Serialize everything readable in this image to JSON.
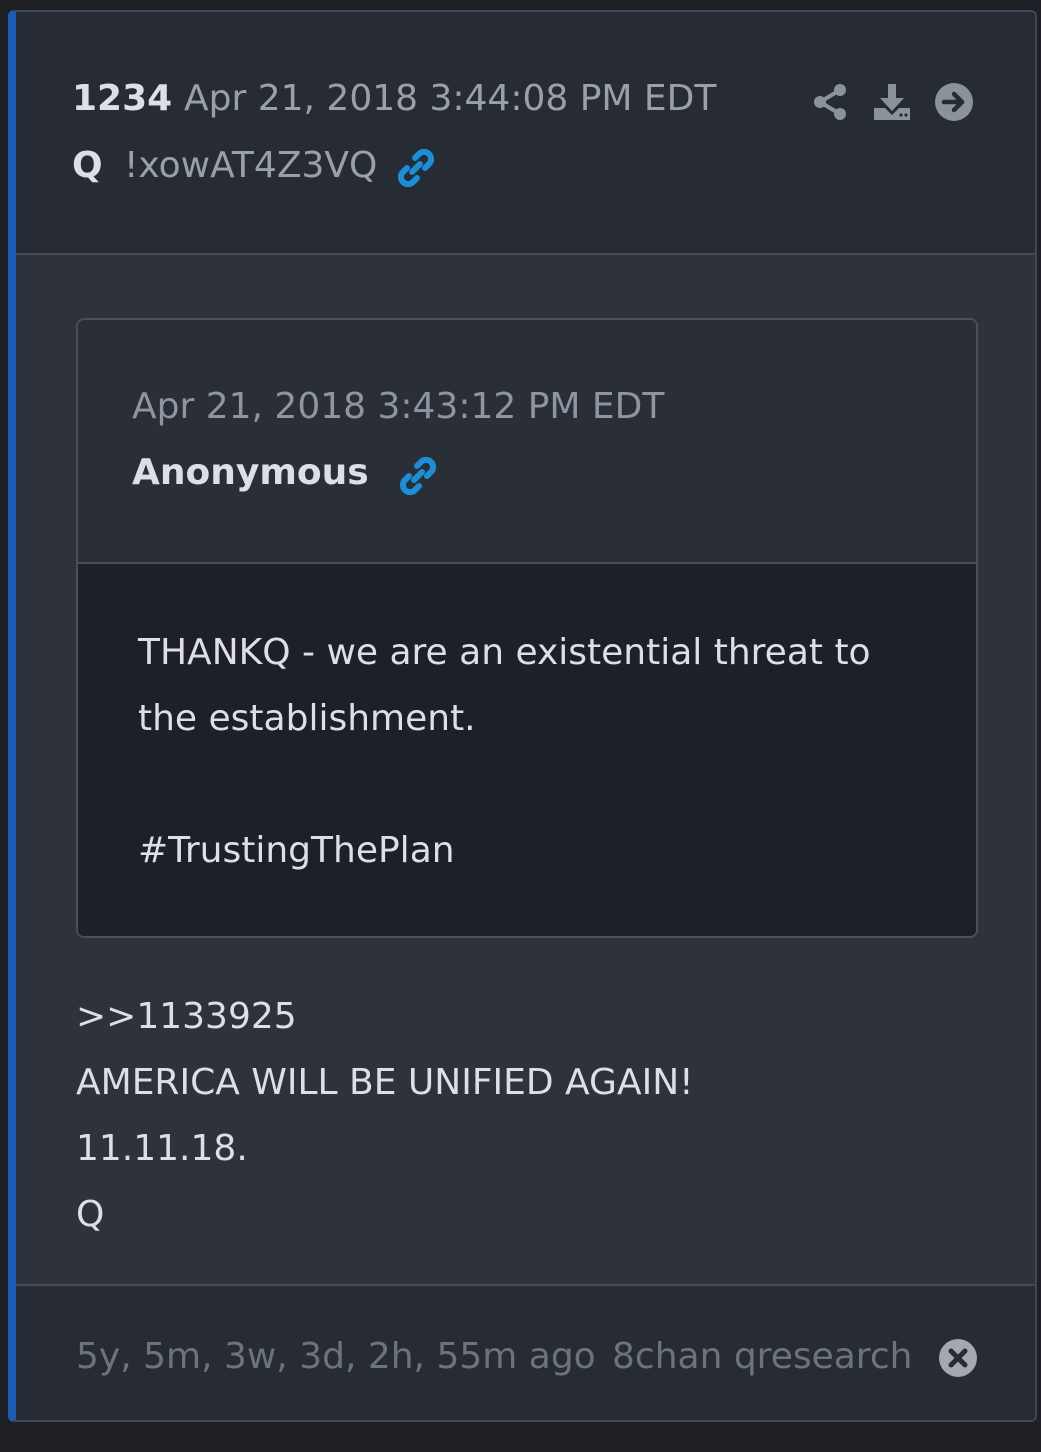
{
  "post": {
    "number": "1234",
    "timestamp": "Apr 21, 2018 3:44:08 PM EDT",
    "author": "Q",
    "tripcode": "!xowAT4Z3VQ"
  },
  "quoted": {
    "timestamp": "Apr 21, 2018 3:43:12 PM EDT",
    "author": "Anonymous",
    "lines": [
      "THANKQ - we are an existential threat to",
      "the establishment.",
      "#TrustingThePlan"
    ]
  },
  "body": {
    "lines": [
      ">>1133925",
      "AMERICA WILL BE UNIFIED AGAIN!",
      "11.11.18.",
      "Q"
    ]
  },
  "footer": {
    "ago": "5y, 5m, 3w, 3d, 2h, 55m ago",
    "source": "8chan qresearch"
  },
  "colors": {
    "accent": "#1d5cb6",
    "link": "#1a8fd6",
    "background": "#2d323b",
    "quote_body": "#1e2027"
  },
  "icons": [
    "share-icon",
    "download-icon",
    "arrow-right-circle-icon",
    "link-icon",
    "close-circle-icon"
  ]
}
